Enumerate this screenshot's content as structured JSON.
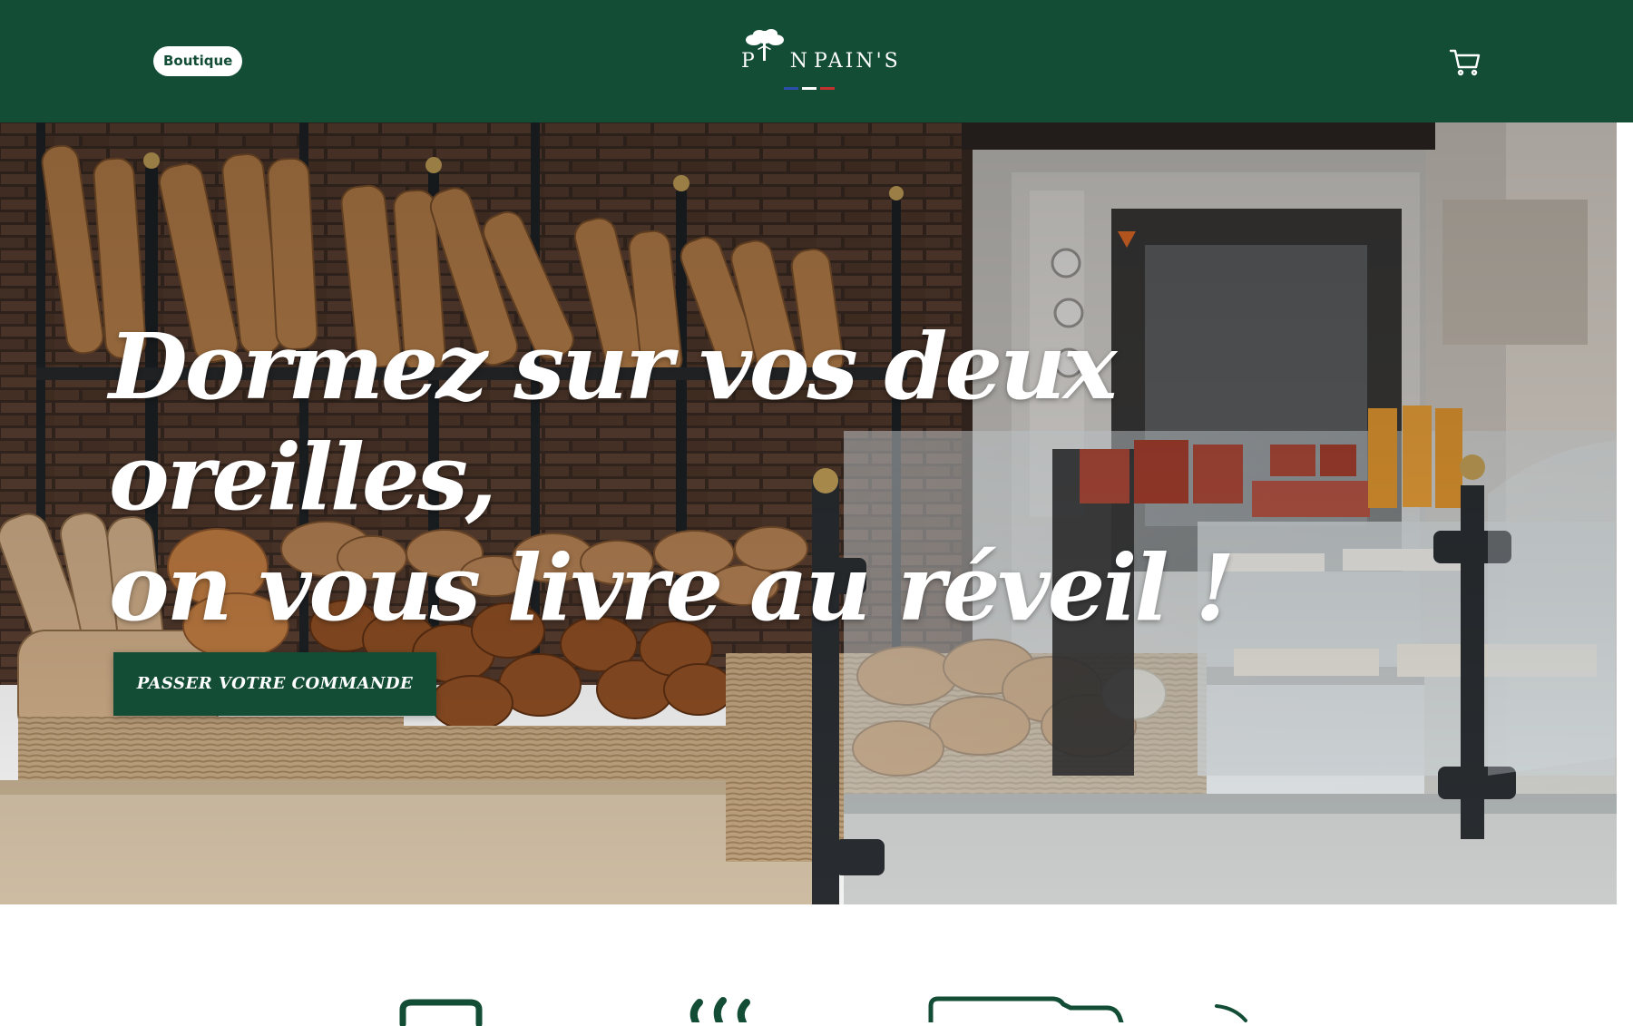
{
  "header": {
    "shop_label": "Boutique",
    "logo_text_left": "P N",
    "logo_text_right": "PAIN'S",
    "cart_icon": "cart-icon",
    "bg_color": "#134d36"
  },
  "hero": {
    "title_line1": "Dormez sur vos deux oreilles,",
    "title_line2": "on vous livre au réveil !",
    "cta_label": "PASSER VOTRE COMMANDE",
    "image": "bakery-counter-photo"
  },
  "features": {
    "icons": [
      "bag-icon",
      "heat-icon",
      "truck-icon",
      "arrow-icon"
    ]
  },
  "colors": {
    "brand": "#134d36",
    "white": "#ffffff"
  }
}
